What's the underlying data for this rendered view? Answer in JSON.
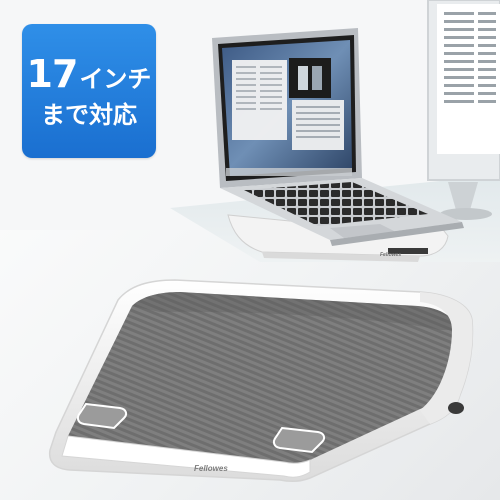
{
  "badge": {
    "number": "17",
    "unit": "インチ",
    "line2": "まで対応",
    "color": "#1a6fd0"
  },
  "brand": {
    "stand_label": "Fellowes",
    "small_stand_label": "Fellowes"
  },
  "colors": {
    "stand_white": "#f2f2f2",
    "stand_gray": "#7d7d7d",
    "laptop_silver": "#c9ccd0",
    "screen_blue": "#5d7fa7"
  }
}
